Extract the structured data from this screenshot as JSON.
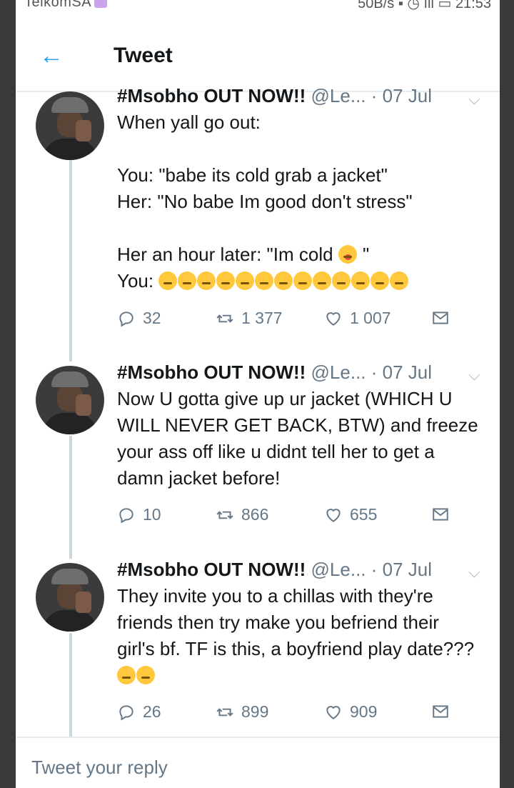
{
  "status_bar": {
    "carrier": "TelkomSA",
    "speed": "50B/s",
    "time": "21:53"
  },
  "header": {
    "title": "Tweet"
  },
  "tweets": [
    {
      "name": "#Msobho OUT NOW!!",
      "handle": "@Le...",
      "date": "07 Jul",
      "lines": [
        "When yall go out:",
        "",
        "You: \"babe its cold grab a jacket\"",
        "Her: \"No babe Im good don't stress\"",
        "",
        "Her an hour later: \"Im cold"
      ],
      "you_line": "You:",
      "replies": "32",
      "retweets": "1 377",
      "likes": "1 007"
    },
    {
      "name": "#Msobho OUT NOW!!",
      "handle": "@Le...",
      "date": "07 Jul",
      "text": "Now U gotta give up ur jacket (WHICH U WILL NEVER GET BACK, BTW) and freeze your ass off like u didnt tell her to get a damn jacket before!",
      "replies": "10",
      "retweets": "866",
      "likes": "655"
    },
    {
      "name": "#Msobho OUT NOW!!",
      "handle": "@Le...",
      "date": "07 Jul",
      "text": "They invite you to a chillas with they're friends then try make you befriend their girl's bf. TF is this, a boyfriend play date???",
      "replies": "26",
      "retweets": "899",
      "likes": "909"
    }
  ],
  "reply_box": {
    "placeholder": "Tweet your reply"
  },
  "colors": {
    "accent": "#1da1f2",
    "muted": "#657786",
    "text": "#14171a"
  }
}
